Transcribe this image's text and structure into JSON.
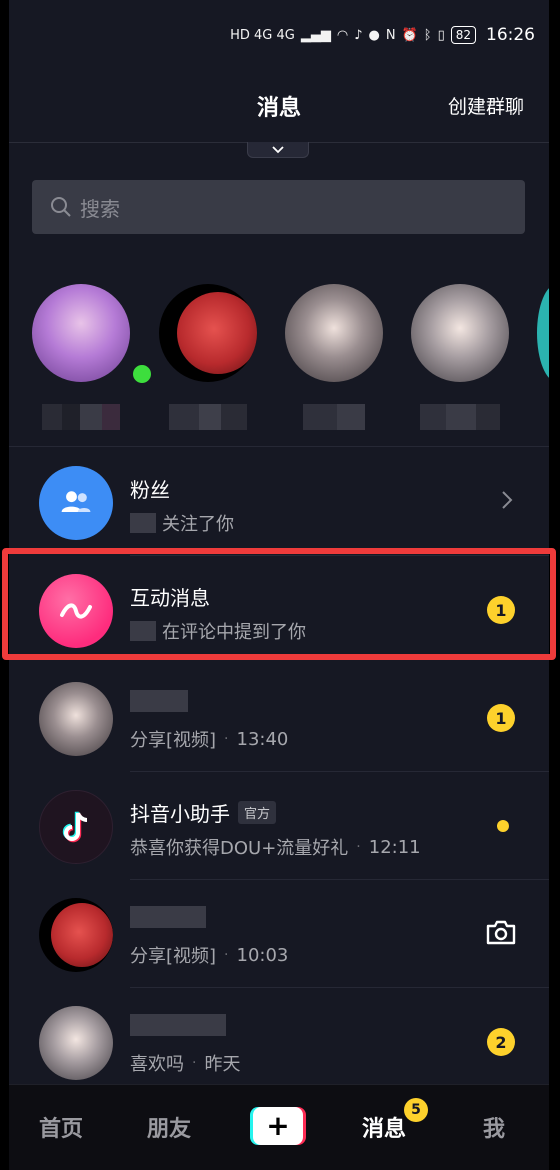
{
  "status_bar": {
    "network": "HD 4G 4G",
    "battery": "82",
    "time": "16:26"
  },
  "header": {
    "title": "消息",
    "action": "创建群聊"
  },
  "search": {
    "placeholder": "搜索"
  },
  "stories": [
    {
      "avatar_color": "#b57bd6",
      "online": true
    },
    {
      "avatar_color": "#c0393b",
      "online": false
    },
    {
      "avatar_color": "#5a5560",
      "online": false
    },
    {
      "avatar_color": "#6e6a72",
      "online": false
    }
  ],
  "messages": [
    {
      "title": "粉丝",
      "subtitle": "关注了你",
      "icon": "fans-icon",
      "avatar_color": "#3d8df5",
      "right": "chevron"
    },
    {
      "title": "互动消息",
      "subtitle": "在评论中提到了你",
      "icon": "interaction-icon",
      "avatar_color": "#fe2c7d",
      "badge": "1",
      "highlighted": true
    },
    {
      "title": "",
      "subtitle": "分享[视频]",
      "time": "13:40",
      "avatar_color": "#5a5560",
      "badge": "1"
    },
    {
      "title": "抖音小助手",
      "tag": "官方",
      "subtitle": "恭喜你获得DOU+流量好礼",
      "time": "12:11",
      "icon": "tiktok-logo-icon",
      "avatar_color": "#1f1420",
      "right": "dot"
    },
    {
      "title": "",
      "subtitle": "分享[视频]",
      "time": "10:03",
      "avatar_color": "#c0393b",
      "right": "camera"
    },
    {
      "title": "",
      "subtitle": "喜欢吗",
      "time": "昨天",
      "avatar_color": "#6e6a72",
      "badge": "2"
    }
  ],
  "tabbar": {
    "home": "首页",
    "friends": "朋友",
    "plus": "+",
    "messages": "消息",
    "messages_badge": "5",
    "me": "我"
  },
  "colors": {
    "background": "#161823",
    "accent_yellow": "#fdd12c",
    "highlight_red": "#ef3b3b"
  }
}
